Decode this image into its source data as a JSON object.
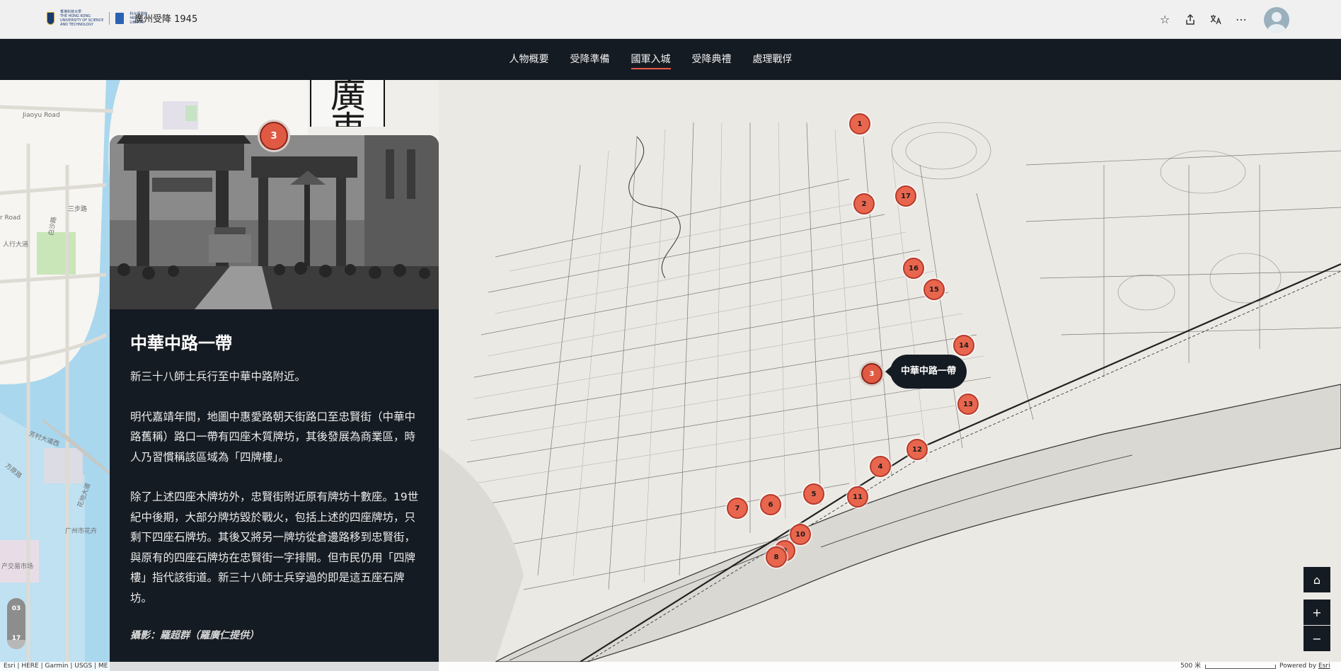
{
  "header": {
    "logo_hkust_lines": [
      "香港科技大學",
      "THE HONG KONG",
      "UNIVERSITY OF SCIENCE",
      "AND TECHNOLOGY"
    ],
    "logo_library_lines": [
      "科大圖書館",
      "HKUST",
      "LIBRARY"
    ],
    "title": "廣州受降 1945",
    "actions": {
      "favorite_icon": "☆",
      "share_icon": "⇪",
      "translate_icon": "文",
      "more_icon": "⋯"
    }
  },
  "nav": {
    "items": [
      {
        "label": "人物概要",
        "active": false
      },
      {
        "label": "受降準備",
        "active": false
      },
      {
        "label": "國軍入城",
        "active": true
      },
      {
        "label": "受降典禮",
        "active": false
      },
      {
        "label": "處理戰俘",
        "active": false
      }
    ]
  },
  "card": {
    "marker_number": "3",
    "title": "中華中路一帶",
    "paragraphs": [
      "新三十八師士兵行至中華中路附近。",
      "明代嘉靖年間，地圖中惠愛路朝天街路口至忠賢街（中華中路舊稱）路口一帶有四座木質牌坊，其後發展為商業區，時人乃習慣稱該區域為「四牌樓」。",
      "除了上述四座木牌坊外，忠賢街附近原有牌坊十數座。19世紀中後期，大部分牌坊毀於戰火，包括上述的四座牌坊，只剩下四座石牌坊。其後又將另一牌坊從倉邊路移到忠賢街，與原有的四座石牌坊在忠賢街一字排開。但市民仍用「四牌樓」指代該街道。新三十八師士兵穿過的即是這五座石牌坊。"
    ],
    "credit": "攝影：羅超群（羅廣仁提供）"
  },
  "map": {
    "tooltip": "中華中路一帶",
    "selected_marker": "3",
    "markers": [
      "1",
      "17",
      "2",
      "16",
      "15",
      "14",
      "3",
      "13",
      "12",
      "4",
      "11",
      "5",
      "6",
      "7",
      "10",
      "9",
      "8"
    ],
    "basemap_labels": [
      "Jiaoyu Road",
      "三步路",
      "r Road",
      "白沙路",
      "芳村大道",
      "芳村大道西",
      "人行大道",
      "花地大道",
      "广州市花卉",
      "方原路",
      "产交易市场"
    ],
    "scan_title_chars": [
      "廣",
      "東"
    ]
  },
  "progress": {
    "current": "03",
    "total": "17",
    "fraction": 0.18
  },
  "controls": {
    "home_icon": "⌂",
    "zoom_in": "+",
    "zoom_out": "−"
  },
  "footer": {
    "attribution": "Esri | HERE | Garmin | USGS | ME",
    "scale_label": "500 米",
    "powered_by_prefix": "Powered by",
    "powered_by_brand": "Esri"
  }
}
